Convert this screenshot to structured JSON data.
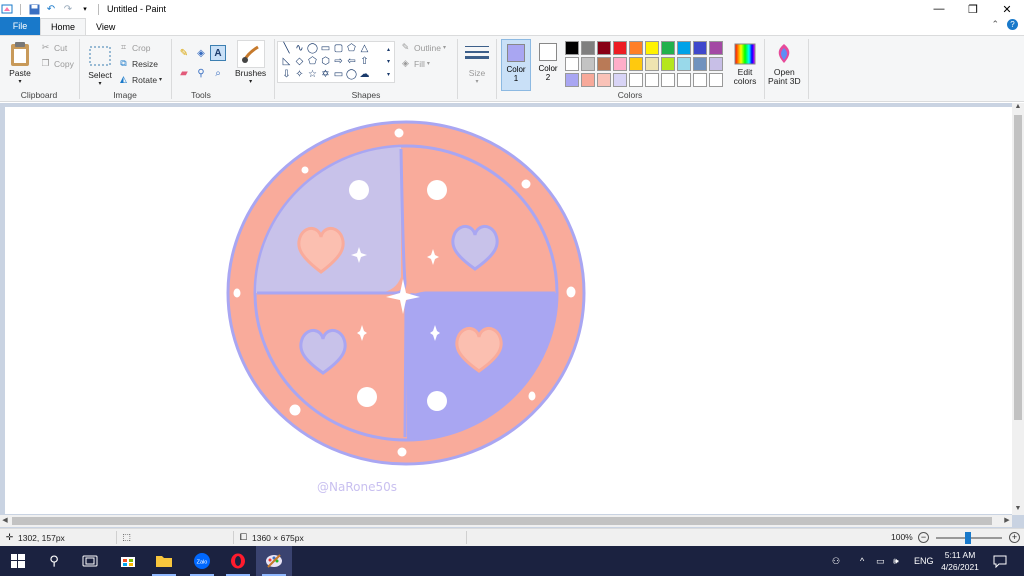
{
  "window": {
    "title": "Untitled - Paint",
    "minimize": "—",
    "restore": "❐",
    "close": "✕"
  },
  "tabs": {
    "file": "File",
    "home": "Home",
    "view": "View",
    "collapse": "⌃"
  },
  "ribbon": {
    "clipboard": {
      "label": "Clipboard",
      "paste": "Paste",
      "cut": "Cut",
      "copy": "Copy"
    },
    "image": {
      "label": "Image",
      "select": "Select",
      "crop": "Crop",
      "resize": "Resize",
      "rotate": "Rotate"
    },
    "tools": {
      "label": "Tools"
    },
    "brushes": {
      "label": "Brushes"
    },
    "shapes": {
      "label": "Shapes",
      "outline": "Outline",
      "fill": "Fill"
    },
    "size": {
      "label": "Size"
    },
    "colors": {
      "label": "Colors",
      "color1": "Color",
      "color1_num": "1",
      "color2": "Color",
      "color2_num": "2",
      "color1_value": "#a9a6f2",
      "color2_value": "#ffffff",
      "edit_colors": "Edit",
      "edit_colors_2": "colors",
      "paint3d": "Open",
      "paint3d_2": "Paint 3D",
      "palette_row1": [
        "#000000",
        "#7f7f7f",
        "#880015",
        "#ed1c24",
        "#ff7f27",
        "#fff200",
        "#22b14c",
        "#00a2e8",
        "#3f48cc",
        "#a349a4"
      ],
      "palette_row2": [
        "#ffffff",
        "#c3c3c3",
        "#b97a57",
        "#ffaec9",
        "#ffc90e",
        "#efe4b0",
        "#b5e61d",
        "#99d9ea",
        "#7092be",
        "#c8bfe7"
      ],
      "palette_row3": [
        "#a9a6f2",
        "#f7a99a",
        "#f9c2b8",
        "#d8d4f6",
        "#ffffff",
        "#ffffff",
        "#ffffff",
        "#ffffff",
        "#ffffff",
        "#ffffff"
      ]
    }
  },
  "canvas": {
    "signature": "@NaRone50s",
    "art_colors": {
      "salmon": "#f9ab9b",
      "periwinkle": "#a9a6f2",
      "lavender": "#c8c2ea",
      "blush": "#fbbfb0"
    }
  },
  "status": {
    "cursor_pos": "1302, 157px",
    "canvas_size": "1360 × 675px",
    "zoom": "100%"
  },
  "taskbar": {
    "lang": "ENG",
    "time": "5:11 AM",
    "date": "4/26/2021"
  }
}
